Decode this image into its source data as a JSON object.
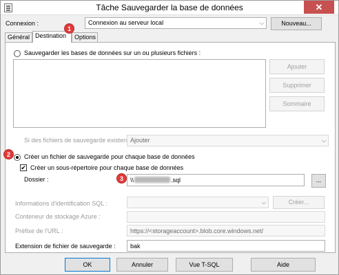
{
  "window": {
    "title": "Tâche Sauvegarder la base de données",
    "close_glyph": "✕"
  },
  "connection": {
    "label": "Connexion :",
    "value": "Connexion au serveur local",
    "new_button": "Nouveau..."
  },
  "tabs": [
    {
      "label": "Général",
      "active": false
    },
    {
      "label": "Destination",
      "active": true
    },
    {
      "label": "Options",
      "active": false
    }
  ],
  "destination": {
    "backup_multiple_label": "Sauvegarder les bases de données sur un ou plusieurs fichiers :",
    "add_button": "Ajouter",
    "remove_button": "Supprimer",
    "summary_button": "Sommaire",
    "if_exists_label": "Si des fichiers de sauvegarde existent :",
    "if_exists_value": "Ajouter",
    "create_file_label": "Créer un fichier de sauvegarde pour chaque base de données",
    "create_subdir_label": "Créer un sous-répertoire pour chaque base de données",
    "create_subdir_checked": true,
    "folder_label": "Dossier :",
    "folder_value_prefix": "\\\\",
    "folder_value_suffix": ".sql",
    "browse_button": "...",
    "sql_credentials_label": "Informations d'identification SQL :",
    "create_button": "Créer...",
    "azure_container_label": "Conteneur de stockage Azure :",
    "url_prefix_label": "Préfixe de l'URL :",
    "url_prefix_value": "https://<storageaccount>.blob.core.windows.net/",
    "extension_label": "Extension de fichier de sauvegarde :",
    "extension_value": "bak"
  },
  "footer": {
    "ok": "OK",
    "cancel": "Annuler",
    "view_tsql": "Vue T-SQL",
    "help": "Aide"
  },
  "annotations": [
    "1",
    "2",
    "3"
  ]
}
